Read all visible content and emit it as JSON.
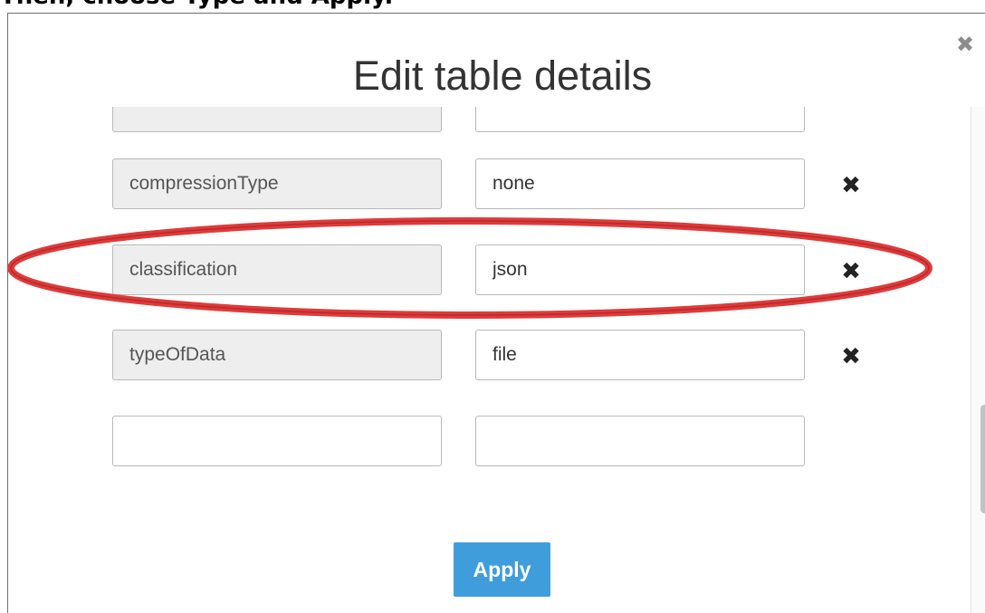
{
  "caption_fragment": "Then, choose Type and Apply.",
  "dialog": {
    "title": "Edit table details",
    "close_icon": "close-icon",
    "apply_label": "Apply"
  },
  "rows": [
    {
      "key": "",
      "value": "",
      "removable": false
    },
    {
      "key": "compressionType",
      "value": "none",
      "removable": true
    },
    {
      "key": "classification",
      "value": "json",
      "removable": true
    },
    {
      "key": "typeOfData",
      "value": "file",
      "removable": true
    },
    {
      "key": "",
      "value": "",
      "removable": false
    }
  ],
  "colors": {
    "accent": "#3f9ddc",
    "annotation": "#e03a3a",
    "key_field_bg": "#eeeeee"
  }
}
